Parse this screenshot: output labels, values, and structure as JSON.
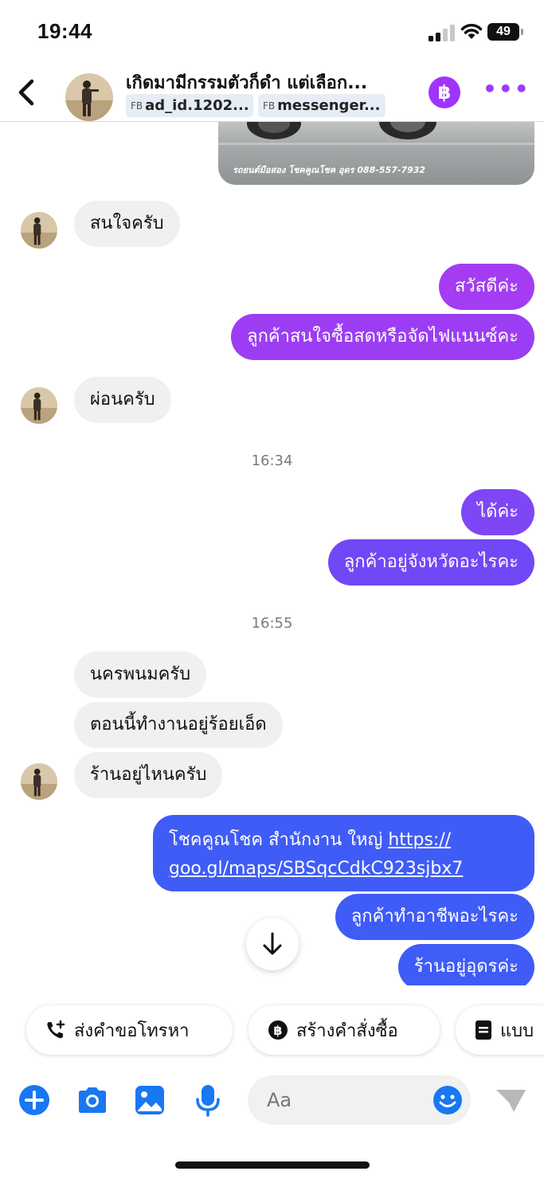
{
  "status_bar": {
    "time": "19:44",
    "battery": "49"
  },
  "header": {
    "contact_name": "เกิดมามีกรรมตัวก็ดำ แต่เลือก...",
    "tags": [
      {
        "prefix": "FB",
        "value": "ad_id.1202..."
      },
      {
        "prefix": "FB",
        "value": "messenger..."
      }
    ],
    "baht_symbol": "฿",
    "more_symbol": "•••"
  },
  "image_message": {
    "caption": "รถยนต์มือสอง โชคคูณโชค อุดร    088-557-7932"
  },
  "messages": [
    {
      "side": "in",
      "text": "สนใจครับ"
    },
    {
      "side": "out",
      "text": "สวัสดีค่ะ"
    },
    {
      "side": "out",
      "text": "ลูกค้าสนใจซื้อสดหรือจัดไฟแนนซ์คะ"
    },
    {
      "side": "in",
      "text": "ผ่อนครับ"
    },
    {
      "side": "timestamp",
      "text": "16:34"
    },
    {
      "side": "out",
      "text": "ได้ค่ะ"
    },
    {
      "side": "out",
      "text": "ลูกค้าอยู่จังหวัดอะไรคะ"
    },
    {
      "side": "timestamp",
      "text": "16:55"
    },
    {
      "side": "in",
      "text": "นครพนมครับ"
    },
    {
      "side": "in",
      "text": "ตอนนี้ทำงานอยู่ร้อยเอ็ด"
    },
    {
      "side": "in",
      "text": "ร้านอยู่ไหนครับ"
    },
    {
      "side": "out",
      "text_prefix": "โชคคูณโชค สำนักงาน ใหญ่ ",
      "link": "https://goo.gl/maps/SBSqcCdkC923sjbx7",
      "link_line1": "https://",
      "link_line2": "goo.gl/maps/SBSqcCdkC923sjbx7"
    },
    {
      "side": "out",
      "text": "ลูกค้าทำอาชีพอะไรคะ"
    },
    {
      "side": "out",
      "text": "ร้านอยู่อุดรค่ะ"
    }
  ],
  "quick_actions": [
    {
      "label": "ส่งคำขอโทรหา",
      "icon": "phone-plus-icon"
    },
    {
      "label": "สร้างคำสั่งซื้อ",
      "icon": "baht-circle-icon"
    },
    {
      "label": "แบบ",
      "icon": "form-icon"
    }
  ],
  "composer": {
    "placeholder": "Aa"
  },
  "colors": {
    "accent_purple": "#9b3dff",
    "bubble_gradient_top": "#a43cf2",
    "bubble_gradient_mid": "#7a44f5",
    "bubble_gradient_bottom": "#3f5cf6",
    "incoming_bubble": "#eff0f2",
    "composer_icon": "#1877f2"
  }
}
